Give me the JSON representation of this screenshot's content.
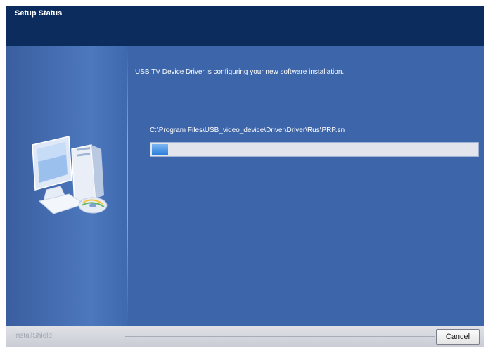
{
  "window": {
    "title": "Setup Status"
  },
  "main": {
    "status_message": "USB TV Device Driver is configuring your new software installation.",
    "current_file": "C:\\Program Files\\USB_video_device\\Driver\\Driver\\Rus\\PRP.sn",
    "progress": 0.05
  },
  "footer": {
    "brand": "InstallShield",
    "cancel_label": "Cancel"
  },
  "colors": {
    "title_bar": "#0c2c5d",
    "content_bg": "#3c65aa",
    "progress_fill": "#2e7fdc",
    "progress_track": "#e2e5ec"
  },
  "icons": {
    "side_art": "computer-install-icon"
  }
}
